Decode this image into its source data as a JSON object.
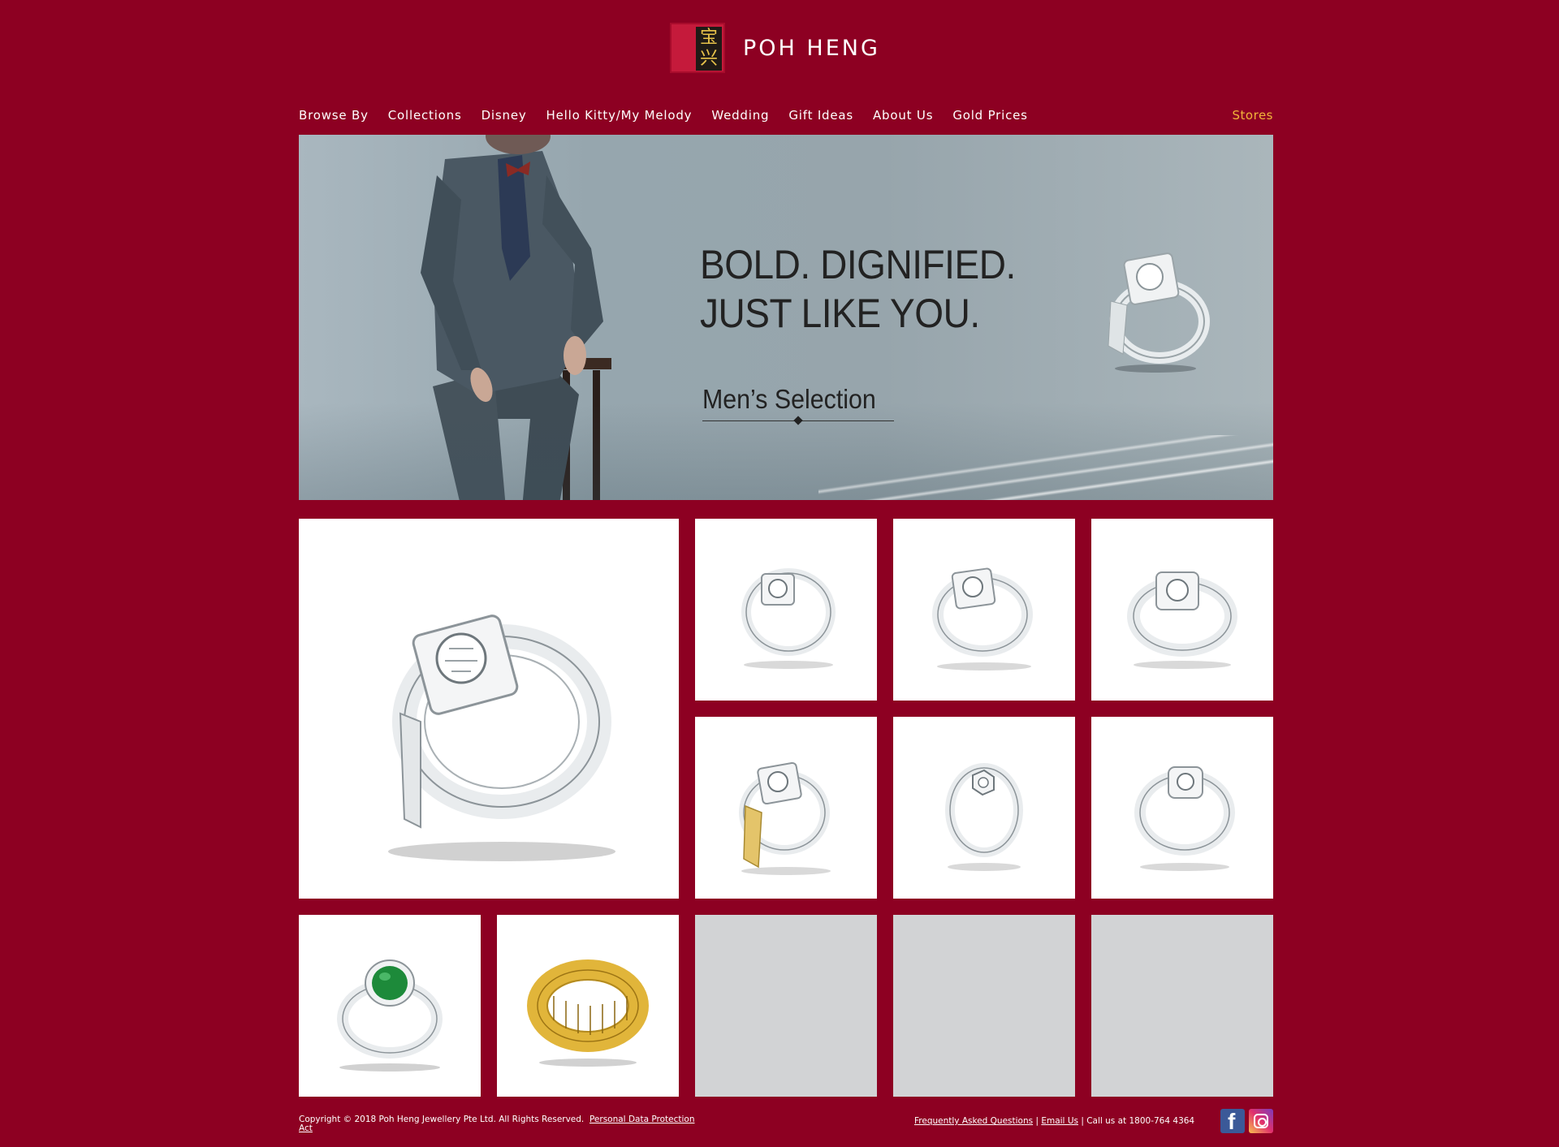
{
  "brand": {
    "name": "POH HENG",
    "glyph_top": "宝",
    "glyph_bottom": "兴",
    "accent_color": "#8d0022",
    "logo_color": "#c51a3b",
    "stores_color": "#f2b53a"
  },
  "nav": {
    "items": [
      {
        "label": "Browse By"
      },
      {
        "label": "Collections"
      },
      {
        "label": "Disney"
      },
      {
        "label": "Hello Kitty/My Melody"
      },
      {
        "label": "Wedding"
      },
      {
        "label": "Gift Ideas"
      },
      {
        "label": "About Us"
      },
      {
        "label": "Gold Prices"
      }
    ],
    "stores_label": "Stores"
  },
  "hero": {
    "title_line1": "BOLD. DIGNIFIED.",
    "title_line2": "JUST LIKE YOU.",
    "subtitle": "Men’s Selection"
  },
  "products": [
    {
      "icon": "diamond-ring-large",
      "metal": "white-gold"
    },
    {
      "icon": "diamond-ring",
      "metal": "white-gold"
    },
    {
      "icon": "diamond-ring",
      "metal": "white-gold"
    },
    {
      "icon": "diamond-ring",
      "metal": "white-gold"
    },
    {
      "icon": "diamond-ring",
      "metal": "two-tone"
    },
    {
      "icon": "hexagon-diamond-ring",
      "metal": "white-gold"
    },
    {
      "icon": "diamond-ring",
      "metal": "white-gold"
    },
    {
      "icon": "jade-ring",
      "metal": "white-gold"
    },
    {
      "icon": "abacus-ring",
      "metal": "yellow-gold"
    }
  ],
  "footer": {
    "copyright": "Copyright © 2018 Poh Heng Jewellery Pte Ltd. All Rights Reserved.",
    "pdpa_label": "Personal Data Protection Act",
    "faq_label": "Frequently Asked Questions",
    "separator": "|",
    "email_label": "Email Us",
    "call_text": "Call us at 1800-764 4364"
  }
}
